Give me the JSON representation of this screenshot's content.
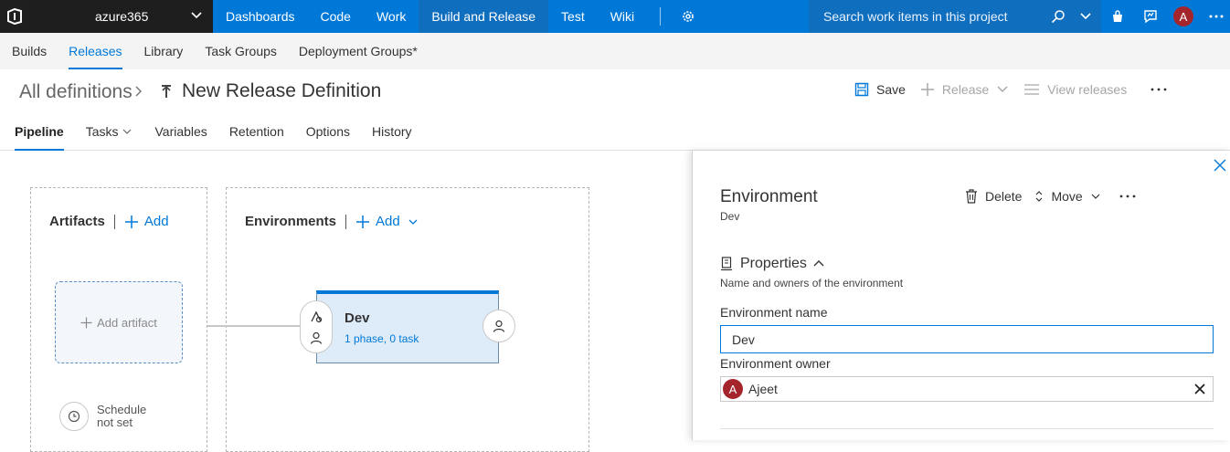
{
  "app": {
    "account": "azure365",
    "nav": [
      "Dashboards",
      "Code",
      "Work",
      "Build and Release",
      "Test",
      "Wiki"
    ],
    "search_placeholder": "Search work items in this project",
    "user_initial": "A"
  },
  "subnav": {
    "items": [
      "Builds",
      "Releases",
      "Library",
      "Task Groups",
      "Deployment Groups*"
    ],
    "active": "Releases"
  },
  "title": {
    "breadcrumb": "All definitions",
    "definition": "New Release Definition",
    "actions": {
      "save": "Save",
      "release": "Release",
      "view_releases": "View releases"
    }
  },
  "tabs": {
    "items": [
      "Pipeline",
      "Tasks",
      "Variables",
      "Retention",
      "Options",
      "History"
    ],
    "active": "Pipeline"
  },
  "pipeline": {
    "artifacts": {
      "label": "Artifacts",
      "add": "Add",
      "add_artifact": "Add artifact"
    },
    "schedule": {
      "line1": "Schedule",
      "line2": "not set"
    },
    "environments": {
      "label": "Environments",
      "add": "Add"
    },
    "env_card": {
      "name": "Dev",
      "summary": "1 phase, 0 task"
    }
  },
  "panel": {
    "title": "Environment",
    "subtitle": "Dev",
    "actions": {
      "delete": "Delete",
      "move": "Move"
    },
    "properties": {
      "heading": "Properties",
      "description": "Name and owners of the environment"
    },
    "env_name": {
      "label": "Environment name",
      "value": "Dev"
    },
    "env_owner": {
      "label": "Environment owner",
      "value": "Ajeet",
      "initial": "A"
    }
  },
  "colors": {
    "accent": "#0078d7",
    "account_bg": "#1e1e1e",
    "avatar": "#a4262c",
    "env_card_bg": "#deecf9"
  }
}
